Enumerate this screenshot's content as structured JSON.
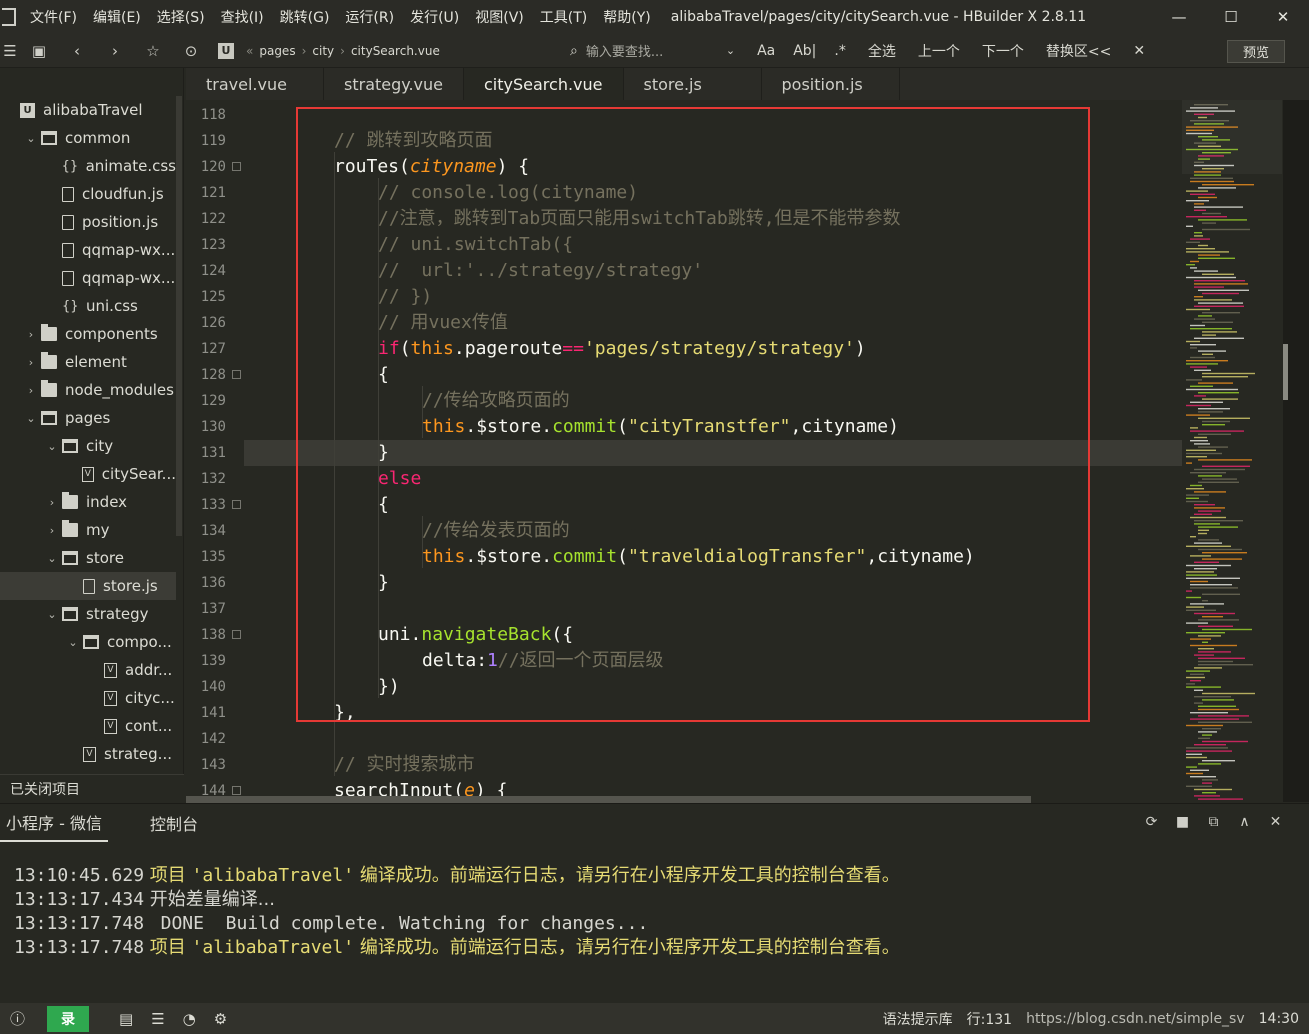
{
  "menubar": {
    "items": [
      "文件(F)",
      "编辑(E)",
      "选择(S)",
      "查找(I)",
      "跳转(G)",
      "运行(R)",
      "发行(U)",
      "视图(V)",
      "工具(T)",
      "帮助(Y)"
    ],
    "window_title": "alibabaTravel/pages/city/citySearch.vue - HBuilder X 2.8.11"
  },
  "toolbar": {
    "breadcrumbs": [
      "pages",
      "city",
      "citySearch.vue"
    ],
    "find_placeholder": "输入要查找...",
    "find_case": "Aa",
    "find_word": "Ab|",
    "find_regex": ".*",
    "select_all": "全选",
    "prev": "上一个",
    "next": "下一个",
    "replace": "替换区<<",
    "preview": "预览"
  },
  "sidebar": {
    "rows": [
      {
        "label": "alibabaTravel",
        "indent": 0,
        "icon": "proj",
        "tw": ""
      },
      {
        "label": "common",
        "indent": 1,
        "icon": "folder-open",
        "tw": "⌄"
      },
      {
        "label": "animate.css",
        "indent": 2,
        "icon": "css",
        "tw": ""
      },
      {
        "label": "cloudfun.js",
        "indent": 2,
        "icon": "file",
        "tw": ""
      },
      {
        "label": "position.js",
        "indent": 2,
        "icon": "file",
        "tw": ""
      },
      {
        "label": "qqmap-wx...",
        "indent": 2,
        "icon": "file",
        "tw": ""
      },
      {
        "label": "qqmap-wx...",
        "indent": 2,
        "icon": "file",
        "tw": ""
      },
      {
        "label": "uni.css",
        "indent": 2,
        "icon": "css",
        "tw": ""
      },
      {
        "label": "components",
        "indent": 1,
        "icon": "folder",
        "tw": "›"
      },
      {
        "label": "element",
        "indent": 1,
        "icon": "folder",
        "tw": "›"
      },
      {
        "label": "node_modules",
        "indent": 1,
        "icon": "folder",
        "tw": "›"
      },
      {
        "label": "pages",
        "indent": 1,
        "icon": "folder-open",
        "tw": "⌄"
      },
      {
        "label": "city",
        "indent": 2,
        "icon": "folder-open",
        "tw": "⌄"
      },
      {
        "label": "citySear...",
        "indent": 3,
        "icon": "vue",
        "tw": ""
      },
      {
        "label": "index",
        "indent": 2,
        "icon": "folder",
        "tw": "›"
      },
      {
        "label": "my",
        "indent": 2,
        "icon": "folder",
        "tw": "›"
      },
      {
        "label": "store",
        "indent": 2,
        "icon": "folder-open",
        "tw": "⌄"
      },
      {
        "label": "store.js",
        "indent": 3,
        "icon": "file",
        "tw": "",
        "selected": true
      },
      {
        "label": "strategy",
        "indent": 2,
        "icon": "folder-open",
        "tw": "⌄"
      },
      {
        "label": "compo...",
        "indent": 3,
        "icon": "folder-open",
        "tw": "⌄"
      },
      {
        "label": "addr...",
        "indent": 4,
        "icon": "vue",
        "tw": ""
      },
      {
        "label": "cityc...",
        "indent": 4,
        "icon": "vue",
        "tw": ""
      },
      {
        "label": "cont...",
        "indent": 4,
        "icon": "vue",
        "tw": ""
      },
      {
        "label": "strateg...",
        "indent": 3,
        "icon": "vue",
        "tw": ""
      }
    ],
    "closed_projects": "已关闭项目"
  },
  "tabs": [
    {
      "label": "travel.vue",
      "active": false
    },
    {
      "label": "strategy.vue",
      "active": false
    },
    {
      "label": "citySearch.vue",
      "active": true
    },
    {
      "label": "store.js",
      "active": false
    },
    {
      "label": "position.js",
      "active": false
    }
  ],
  "editor": {
    "line_numbers": [
      "118",
      "119",
      "120",
      "121",
      "122",
      "123",
      "124",
      "125",
      "126",
      "127",
      "128",
      "129",
      "130",
      "131",
      "132",
      "133",
      "134",
      "135",
      "136",
      "137",
      "138",
      "139",
      "140",
      "141",
      "142",
      "143",
      "144"
    ],
    "fold_lines": [
      "120",
      "128",
      "133",
      "138",
      "144"
    ],
    "current_line": "131",
    "code": {
      "l119": "// 跳转到攻略页面",
      "l120_name": "rouTes",
      "l120_param": "cityname",
      "l121": "// console.log(cityname)",
      "l122": "//注意，跳转到Tab页面只能用switchTab跳转,但是不能带参数",
      "l123": "// uni.switchTab({",
      "l124": "//  url:'../strategy/strategy'",
      "l125": "// })",
      "l126": "// 用vuex传值",
      "l127_kw": "if",
      "l127_this": "this",
      "l127_prop": "pageroute",
      "l127_op": "==",
      "l127_str": "'pages/strategy/strategy'",
      "l129": "//传给攻略页面的",
      "l130_this": "this",
      "l130_store": "$store",
      "l130_commit": "commit",
      "l130_str": "\"cityTranstfer\"",
      "l130_arg": "cityname",
      "l132": "else",
      "l134": "//传给发表页面的",
      "l135_this": "this",
      "l135_store": "$store",
      "l135_commit": "commit",
      "l135_str": "\"traveldialogTransfer\"",
      "l135_arg": "cityname",
      "l138_obj": "uni",
      "l138_fn": "navigateBack",
      "l139_key": "delta",
      "l139_num": "1",
      "l139_cmt": "//返回一个页面层级",
      "l143": "// 实时搜索城市",
      "l144_name": "searchInput",
      "l144_param": "e"
    }
  },
  "console": {
    "tabs": [
      "小程序 - 微信",
      "控制台"
    ],
    "logs": [
      {
        "time": "13:10:45.629",
        "prefix": "项目",
        "project": "'alibabaTravel'",
        "msg": "编译成功。前端运行日志，请另行在小程序开发工具的控制台查看。",
        "type": "success"
      },
      {
        "time": "13:13:17.434",
        "msg": "开始差量编译...",
        "type": "info"
      },
      {
        "time": "13:13:17.748",
        "msg": " DONE  Build complete. Watching for changes...",
        "type": "done"
      },
      {
        "time": "13:13:17.748",
        "prefix": "项目",
        "project": "'alibabaTravel'",
        "msg": "编译成功。前端运行日志，请另行在小程序开发工具的控制台查看。",
        "type": "success"
      }
    ]
  },
  "statusbar": {
    "login": "录",
    "hint": "语法提示库",
    "position": "行:131",
    "watermark": "https://blog.csdn.net/simple_sv",
    "time": "14:30"
  },
  "colors": {
    "bg": "#272822",
    "highlight_box": "#e53935",
    "login_green": "#2fa84f"
  }
}
